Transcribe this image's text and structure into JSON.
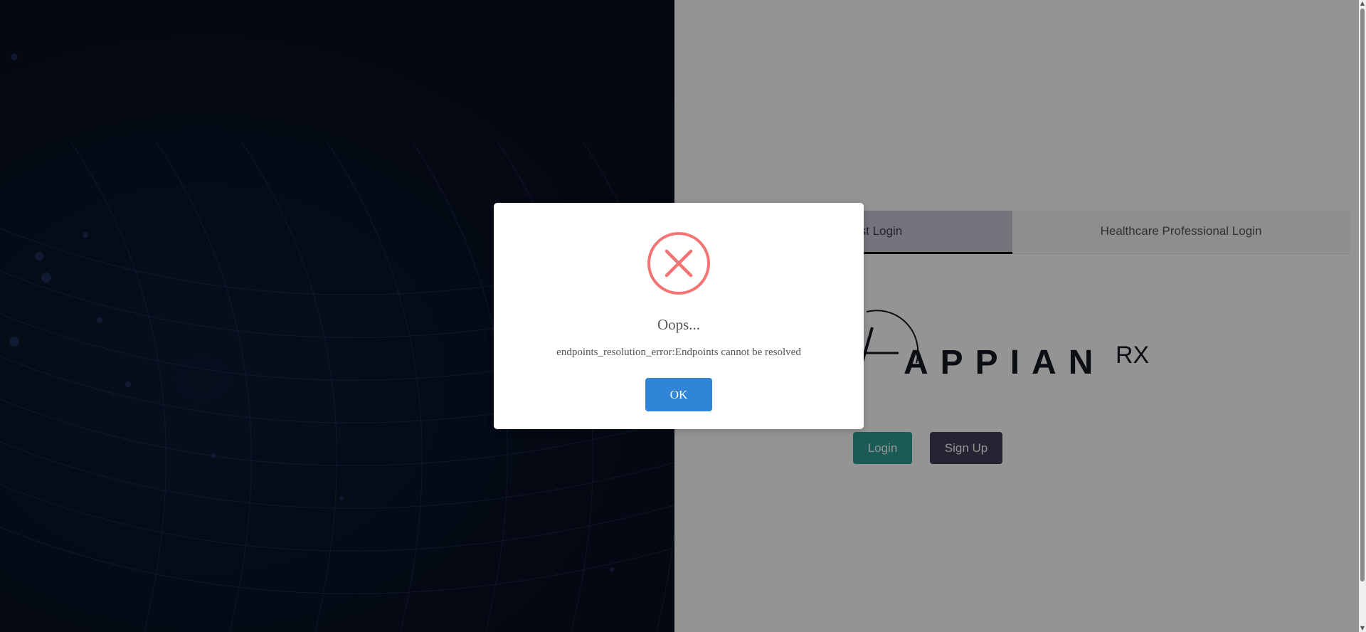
{
  "tabs": [
    {
      "label": "Support Analyst Login",
      "active": true
    },
    {
      "label": "Healthcare Professional Login",
      "active": false
    }
  ],
  "logo": {
    "text": "APPIAN",
    "suffix": "RX"
  },
  "buttons": {
    "login_label": "Login",
    "signup_label": "Sign Up"
  },
  "dialog": {
    "icon": "error-x-icon",
    "title": "Oops...",
    "message": "endpoints_resolution_error:Endpoints cannot be resolved",
    "ok_label": "OK"
  },
  "colors": {
    "accent_login": "#2f9e94",
    "accent_signup": "#3e3f58",
    "dialog_ok": "#3085d6",
    "error_icon": "#f27474",
    "left_bg": "#081225"
  }
}
